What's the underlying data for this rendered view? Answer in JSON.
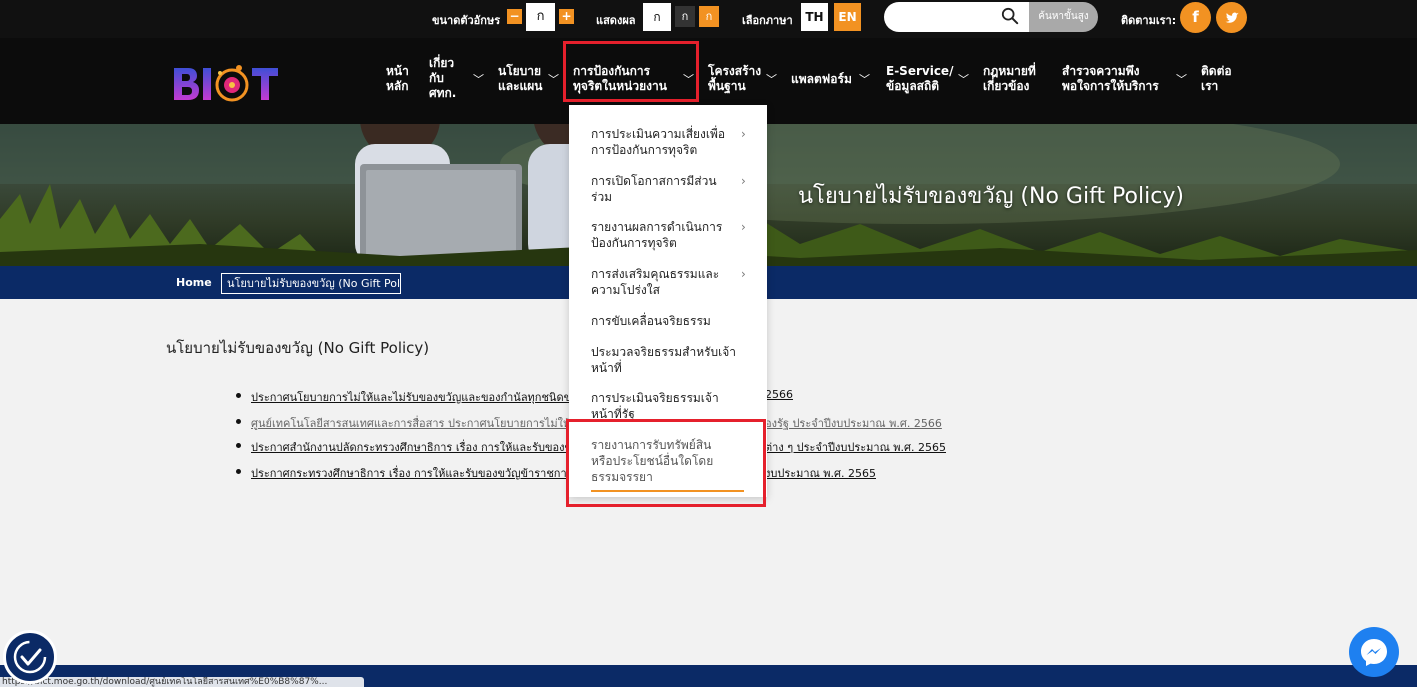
{
  "topbar": {
    "font_size_label": "ขนาดตัวอักษร",
    "font_minus": "−",
    "font_sample": "ก",
    "font_plus": "+",
    "display_label": "แสดงผล",
    "display_options": [
      "ก",
      "ก",
      "ก"
    ],
    "language_label": "เลือกภาษา",
    "lang_th": "TH",
    "lang_en": "EN",
    "search_placeholder": "",
    "advanced_search": "ค้นหาขั้นสูง",
    "follow_label": "ติดตามเรา:",
    "facebook_glyph": "f"
  },
  "nav": [
    {
      "label_1": "หน้า",
      "label_2": "หลัก"
    },
    {
      "label_1": "เกี่ยว",
      "label_2": "กับ",
      "label_3": "ศทก."
    },
    {
      "label_1": "นโยบาย",
      "label_2": "และแผน"
    },
    {
      "label_1": "การป้องกันการ",
      "label_2": "ทุจริตในหน่วยงาน"
    },
    {
      "label_1": "โครงสร้าง",
      "label_2": "พื้นฐาน"
    },
    {
      "label_1": "แพลตฟอร์ม"
    },
    {
      "label_1": "E-Service/",
      "label_2": "ข้อมูลสถิติ"
    },
    {
      "label_1": "กฎหมายที่",
      "label_2": "เกี่ยวข้อง"
    },
    {
      "label_1": "สำรวจความพึง",
      "label_2": "พอใจการให้บริการ"
    },
    {
      "label_1": "ติดต่อ",
      "label_2": "เรา"
    }
  ],
  "dropdown": [
    {
      "line_1": "การประเมินความเสี่ยงเพื่อ",
      "line_2": "การป้องกันการทุจริต",
      "has_sub": true
    },
    {
      "line_1": "การเปิดโอกาสการมีส่วน",
      "line_2": "ร่วม",
      "has_sub": true
    },
    {
      "line_1": "รายงานผลการดำเนินการ",
      "line_2": "ป้องกันการทุจริต",
      "has_sub": true
    },
    {
      "line_1": "การส่งเสริมคุณธรรมและ",
      "line_2": "ความโปร่งใส",
      "has_sub": true
    },
    {
      "line_1": "การขับเคลื่อนจริยธรรม"
    },
    {
      "line_1": "ประมวลจริยธรรมสำหรับเจ้า",
      "line_2": "หน้าที่"
    },
    {
      "line_1": "การประเมินจริยธรรมเจ้า",
      "line_2": "หน้าที่รัฐ"
    },
    {
      "line_1": "รายงานการรับทรัพย์สิน",
      "line_2": "หรือประโยชน์อื่นใดโดย",
      "line_3": "ธรรมจรรยา"
    }
  ],
  "hero": {
    "title": "นโยบายไม่รับของขวัญ (No Gift Policy)"
  },
  "breadcrumb": {
    "home": "Home",
    "current": "นโยบายไม่รับของขวัญ (No Gift Pol..."
  },
  "content": {
    "title": "นโยบายไม่รับของขวัญ (No Gift Policy)",
    "links": [
      {
        "left": "ประกาศนโยบายการไม่ให้และไม่รับของขวัญและของกำนัลทุกชนิดของเจ้าหน",
        "right": "2566"
      },
      {
        "left": "ศูนย์เทคโนโลยีสารสนเทศและการสื่อสาร ประกาศนโยบายการไม่ให้และไม่รั",
        "right": "องรัฐ ประจำปีงบประมาณ พ.ศ. 2566"
      },
      {
        "left": "ประกาศสำนักงานปลัดกระทรวงศึกษาธิการ เรื่อง การให้และรับของขวัญห",
        "right": "ต่าง ๆ ประจำปีงบประมาณ พ.ศ. 2565"
      },
      {
        "left": "ประกาศกระทรวงศึกษาธิการ เรื่อง การให้และรับของขวัญข้าราชการชั้นผู้ใ",
        "right": "งบประมาณ พ.ศ. 2565"
      }
    ]
  },
  "status_url": "https://bict.moe.go.th/download/ศูนย์เทคโนโลยีสารสนเทศ%E0%B8%87%..."
}
